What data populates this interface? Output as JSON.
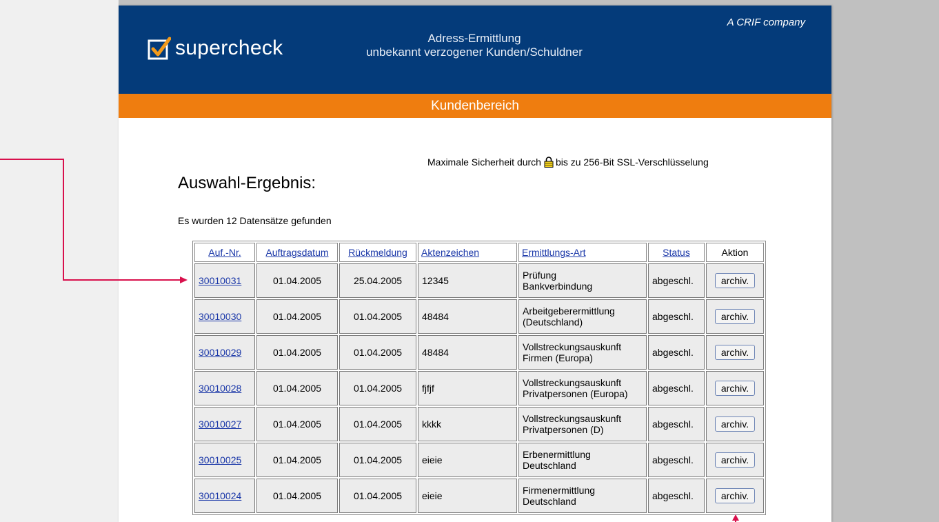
{
  "header": {
    "logo_text": "supercheck",
    "title_line1": "Adress-Ermittlung",
    "title_line2": "unbekannt verzogener Kunden/Schuldner",
    "crif": "A  CRIF company"
  },
  "orange_bar": {
    "label": "Kundenbereich"
  },
  "ssl": {
    "before": "Maximale Sicherheit durch",
    "after": "bis zu 256-Bit SSL-Verschlüsselung"
  },
  "heading": "Auswahl-Ergebnis:",
  "count_text": "Es wurden 12 Datensätze gefunden",
  "table": {
    "columns": [
      "Auf.-Nr.",
      "Auftragsdatum",
      "Rückmeldung",
      "Aktenzeichen",
      "Ermittlungs-Art",
      "Status",
      "Aktion"
    ],
    "button_label": "archiv.",
    "rows": [
      {
        "nr": "30010031",
        "auftrag": "01.04.2005",
        "rueck": "25.04.2005",
        "akten": "12345",
        "art1": "Prüfung",
        "art2": "Bankverbindung",
        "status": "abgeschl."
      },
      {
        "nr": "30010030",
        "auftrag": "01.04.2005",
        "rueck": "01.04.2005",
        "akten": "48484",
        "art1": "Arbeitgeberermittlung",
        "art2": "(Deutschland)",
        "status": "abgeschl."
      },
      {
        "nr": "30010029",
        "auftrag": "01.04.2005",
        "rueck": "01.04.2005",
        "akten": "48484",
        "art1": "Vollstreckungsauskunft",
        "art2": "Firmen (Europa)",
        "status": "abgeschl."
      },
      {
        "nr": "30010028",
        "auftrag": "01.04.2005",
        "rueck": "01.04.2005",
        "akten": "fjfjf",
        "art1": "Vollstreckungsauskunft",
        "art2": "Privatpersonen (Europa)",
        "status": "abgeschl."
      },
      {
        "nr": "30010027",
        "auftrag": "01.04.2005",
        "rueck": "01.04.2005",
        "akten": "kkkk",
        "art1": "Vollstreckungsauskunft",
        "art2": "Privatpersonen (D)",
        "status": "abgeschl."
      },
      {
        "nr": "30010025",
        "auftrag": "01.04.2005",
        "rueck": "01.04.2005",
        "akten": "eieie",
        "art1": "Erbenermittlung",
        "art2": "Deutschland",
        "status": "abgeschl."
      },
      {
        "nr": "30010024",
        "auftrag": "01.04.2005",
        "rueck": "01.04.2005",
        "akten": "eieie",
        "art1": "Firmenermittlung",
        "art2": "Deutschland",
        "status": "abgeschl."
      }
    ]
  },
  "colors": {
    "header_blue": "#043b7a",
    "orange": "#ef7d0f",
    "annotation": "#d8104c",
    "link": "#1a37a8"
  }
}
